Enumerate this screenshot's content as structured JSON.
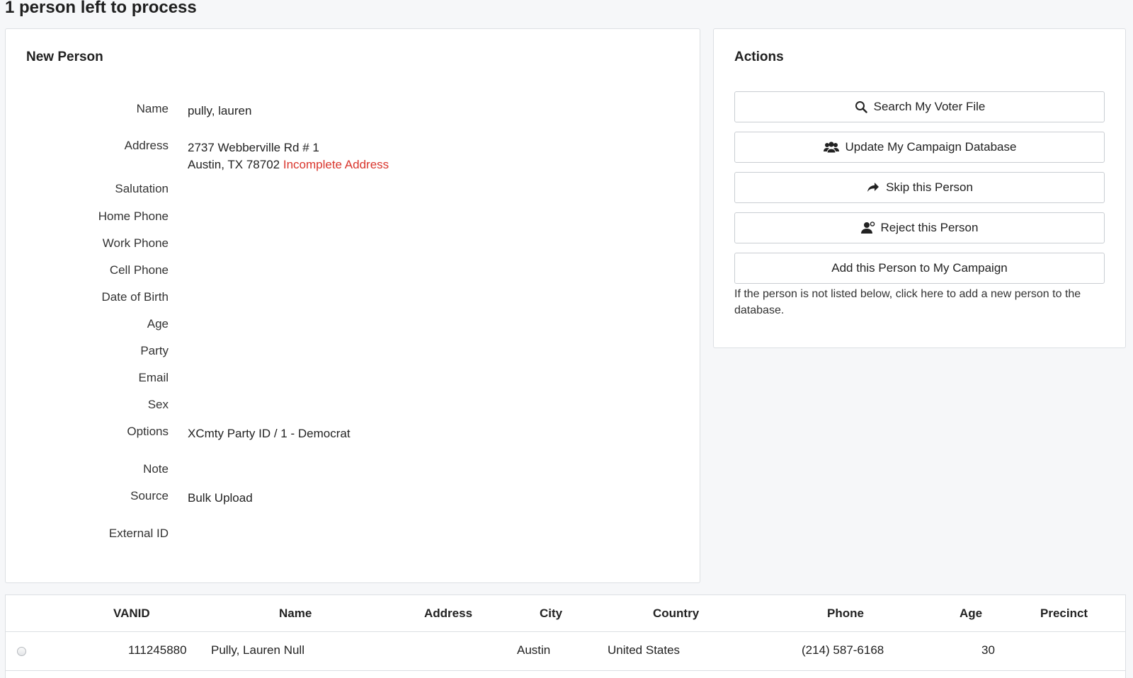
{
  "page": {
    "title": "1 person left to process"
  },
  "new_person": {
    "heading": "New Person",
    "fields": [
      {
        "label": "Name",
        "value": "pully, lauren"
      },
      {
        "label": "Address",
        "line1": "2737 Webberville Rd # 1",
        "line2": "Austin, TX 78702",
        "warning": "Incomplete Address"
      },
      {
        "label": "Salutation",
        "value": ""
      },
      {
        "label": "Home Phone",
        "value": ""
      },
      {
        "label": "Work Phone",
        "value": ""
      },
      {
        "label": "Cell Phone",
        "value": ""
      },
      {
        "label": "Date of Birth",
        "value": ""
      },
      {
        "label": "Age",
        "value": ""
      },
      {
        "label": "Party",
        "value": ""
      },
      {
        "label": "Email",
        "value": ""
      },
      {
        "label": "Sex",
        "value": ""
      },
      {
        "label": "Options",
        "value": "XCmty Party ID / 1 - Democrat"
      },
      {
        "label": "Note",
        "value": ""
      },
      {
        "label": "Source",
        "value": "Bulk Upload"
      },
      {
        "label": "External ID",
        "value": ""
      }
    ]
  },
  "actions": {
    "heading": "Actions",
    "buttons": [
      {
        "label": "Search My Voter File",
        "icon": "search-icon"
      },
      {
        "label": "Update My Campaign Database",
        "icon": "users-icon"
      },
      {
        "label": "Skip this Person",
        "icon": "share-arrow-icon"
      },
      {
        "label": "Reject this Person",
        "icon": "user-reject-icon"
      },
      {
        "label": "Add this Person to My Campaign",
        "icon": ""
      }
    ],
    "help_text": "If the person is not listed below, click here to add a new person to the database."
  },
  "results": {
    "columns": [
      "VANID",
      "Name",
      "Address",
      "City",
      "Country",
      "Phone",
      "Age",
      "Precinct"
    ],
    "rows": [
      {
        "vanid": "111245880",
        "name": "Pully, Lauren Null",
        "address": "",
        "city": "Austin",
        "country": "United States",
        "phone": "(214) 587-6168",
        "age": "30",
        "precinct": ""
      }
    ]
  },
  "colors": {
    "warning": "#d9352c",
    "border": "#dcdfe3",
    "background": "#f6f7f9"
  }
}
